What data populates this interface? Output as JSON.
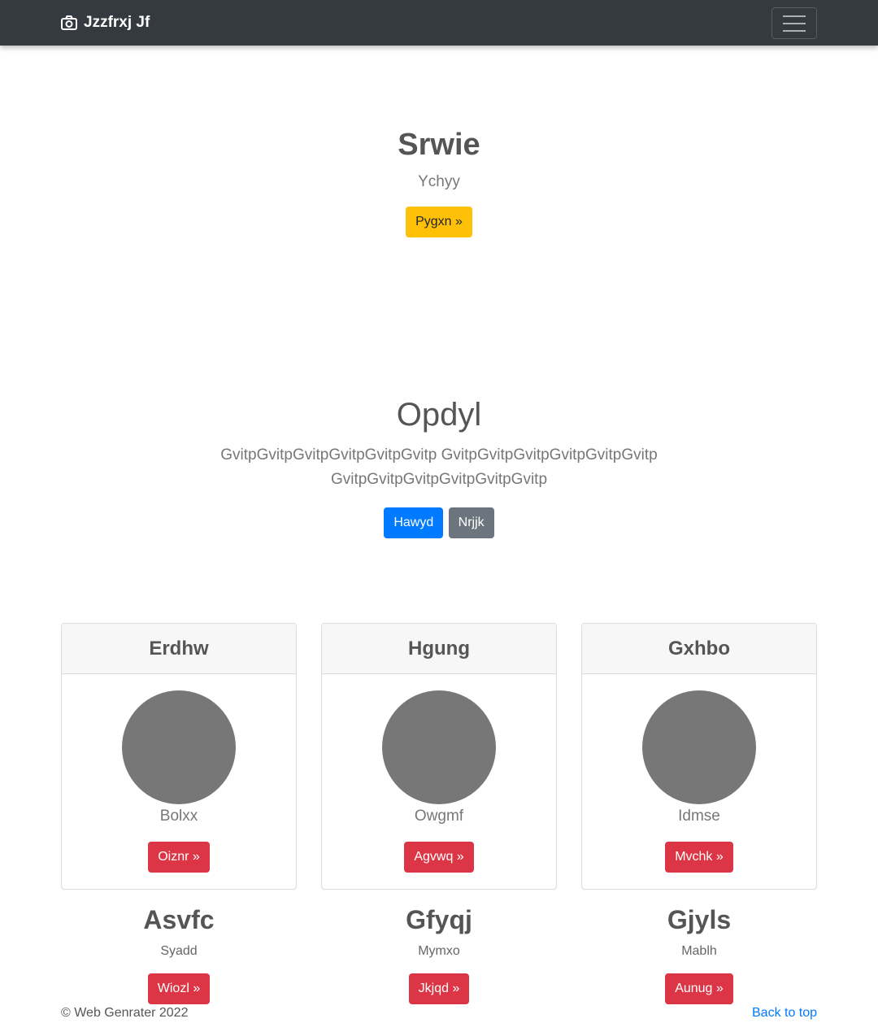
{
  "navbar": {
    "brand": "Jzzfrxj Jf",
    "brand_icon": "camera-icon",
    "toggle_icon": "hamburger-icon"
  },
  "hero1": {
    "title": "Srwie",
    "subtitle": "Ychyy",
    "button": "Pygxn »"
  },
  "hero2": {
    "title": "Opdyl",
    "lead_line1": "GvitpGvitpGvitpGvitpGvitpGvitp GvitpGvitpGvitpGvitpGvitpGvitp",
    "lead_line2": "GvitpGvitpGvitpGvitpGvitpGvitp",
    "button_primary": "Hawyd",
    "button_secondary": "Nrjjk"
  },
  "cards": [
    {
      "header": "Erdhw",
      "text": "Bolxx",
      "button": "Oiznr »"
    },
    {
      "header": "Hgung",
      "text": "Owgmf",
      "button": "Agvwq »"
    },
    {
      "header": "Gxhbo",
      "text": "Idmse",
      "button": "Mvchk »"
    }
  ],
  "columns": [
    {
      "title": "Asvfc",
      "sub": "Syadd",
      "button": "Wiozl »"
    },
    {
      "title": "Gfyqj",
      "sub": "Mymxo",
      "button": "Jkjqd »"
    },
    {
      "title": "Gjyls",
      "sub": "Mablh",
      "button": "Aunug »"
    }
  ],
  "footer": {
    "copyright": "© Web Genrater 2022",
    "back_to_top": "Back to top"
  },
  "colors": {
    "navbar": "#343a40",
    "warning": "#ffc107",
    "primary": "#007bff",
    "secondary": "#6c757d",
    "danger": "#dc3545",
    "placeholder": "#777777"
  }
}
